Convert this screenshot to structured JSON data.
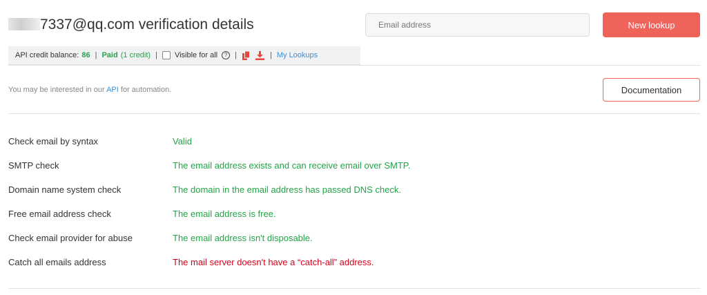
{
  "header": {
    "title_suffix": "7337@qq.com verification details",
    "email_placeholder": "Email address",
    "new_lookup_label": "New lookup"
  },
  "info_bar": {
    "credit_label": "API credit balance:",
    "credit_value": "86",
    "sep": "|",
    "paid_label": "Paid",
    "paid_detail": "(1 credit)",
    "visible_label": "Visible for all",
    "my_lookups_label": "My Lookups"
  },
  "api_notice": {
    "prefix": "You may be interested in our",
    "link": "API",
    "suffix": "for automation."
  },
  "documentation_label": "Documentation",
  "checks": [
    {
      "label": "Check email by syntax",
      "result": "Valid",
      "status": "ok"
    },
    {
      "label": "SMTP check",
      "result": "The email address exists and can receive email over SMTP.",
      "status": "ok"
    },
    {
      "label": "Domain name system check",
      "result": "The domain in the email address has passed DNS check.",
      "status": "ok"
    },
    {
      "label": "Free email address check",
      "result": "The email address is free.",
      "status": "ok"
    },
    {
      "label": "Check email provider for abuse",
      "result": "The email address isn't disposable.",
      "status": "ok"
    },
    {
      "label": "Catch all emails address",
      "result": "The mail server doesn't have a “catch-all” address.",
      "status": "bad"
    }
  ],
  "colors": {
    "accent": "#f0635a",
    "success": "#22a447",
    "error": "#d0021b",
    "link": "#3a8fd8"
  },
  "icons": [
    "help-icon",
    "copy-icon",
    "download-icon"
  ]
}
